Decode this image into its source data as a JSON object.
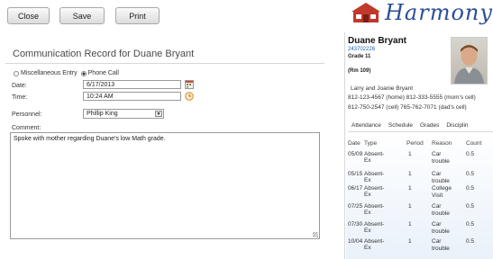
{
  "toolbar": {
    "close_label": "Close",
    "save_label": "Save",
    "print_label": "Print"
  },
  "form": {
    "title": "Communication Record for Duane Bryant",
    "options": [
      "Miscellaneous Entry",
      "Phone Call"
    ],
    "selected_option": "Phone Call",
    "date_label": "Date:",
    "date_value": "6/17/2013",
    "time_label": "Time:",
    "time_value": "10:24 AM",
    "personnel_label": "Personnel:",
    "personnel_value": "Phillip King",
    "comment_label": "Comment:",
    "comment_value": "Spoke with mother regarding Duane's low Math grade."
  },
  "brand": {
    "name": "Harmony",
    "color": "#2b4e97",
    "icon": "school-house-icon"
  },
  "student": {
    "name": "Duane Bryant",
    "id": "243702226",
    "grade": "Grade 11",
    "room": "(Rm 109)",
    "parents": "Larry and Joanie Bryant",
    "phone_line1": "812-123-4567 (home) 812-333-5555 (mom's cell)",
    "phone_line2": "812-750-2547 (cell)    765-762-7071 (dad's cell)"
  },
  "tabs": [
    "Attendance",
    "Schedule",
    "Grades",
    "Disciplin"
  ],
  "attendance": {
    "headers": [
      "Date",
      "Type",
      "Period",
      "Reason",
      "Count"
    ],
    "rows": [
      {
        "date": "05/09",
        "type": "Absent-Ex",
        "period": "1",
        "reason1": "Car",
        "reason2": "trouble",
        "count": "0.5"
      },
      {
        "date": "05/15",
        "type": "Absent-Ex",
        "period": "1",
        "reason1": "Car",
        "reason2": "trouble",
        "count": "0.5"
      },
      {
        "date": "06/17",
        "type": "Absent-Ex",
        "period": "1",
        "reason1": "College",
        "reason2": "Visit",
        "count": "0.5"
      },
      {
        "date": "07/25",
        "type": "Absent-Ex",
        "period": "1",
        "reason1": "Car",
        "reason2": "trouble",
        "count": "0.5"
      },
      {
        "date": "07/30",
        "type": "Absent-Ex",
        "period": "1",
        "reason1": "Car",
        "reason2": "trouble",
        "count": "0.5"
      },
      {
        "date": "10/04",
        "type": "Absent-Ex",
        "period": "1",
        "reason1": "Car",
        "reason2": "trouble",
        "count": "0.5"
      }
    ]
  }
}
